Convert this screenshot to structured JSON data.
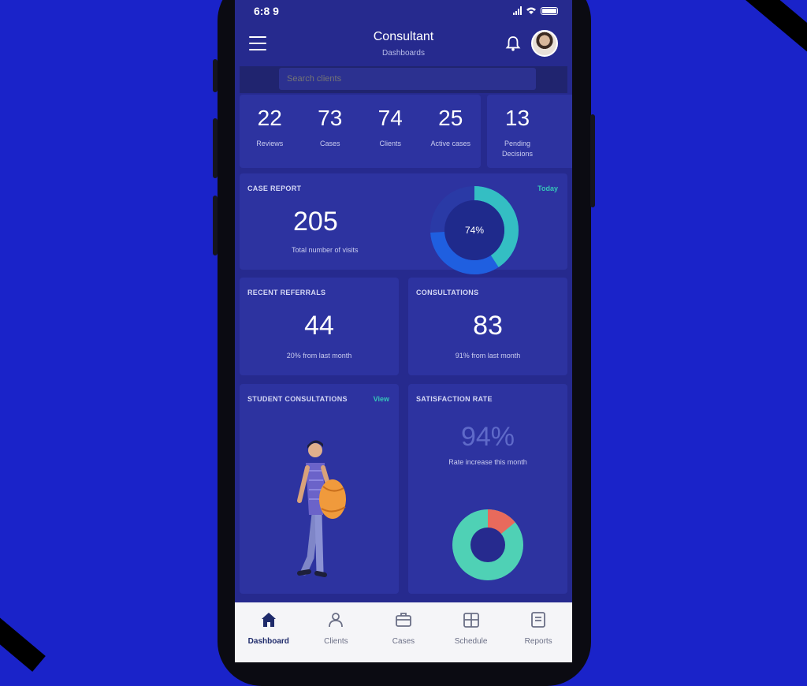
{
  "status": {
    "time": "6:8 9"
  },
  "header": {
    "title": "Consultant",
    "subtitle": "Dashboards"
  },
  "search": {
    "placeholder": "Search clients"
  },
  "stats": [
    {
      "value": "22",
      "label": "Reviews"
    },
    {
      "value": "73",
      "label": "Cases"
    },
    {
      "value": "74",
      "label": "Clients"
    },
    {
      "value": "25",
      "label": "Active cases"
    },
    {
      "value": "13",
      "label": "Pending Decisions"
    }
  ],
  "cases_card": {
    "title": "Case Report",
    "tag": "Today",
    "value": "205",
    "caption": "Total number of visits",
    "donut_label": "74%",
    "donut_percent": 74,
    "colors": {
      "primary": "#1f5fe0",
      "secondary": "#36c9c0",
      "track": "#2a3aa6"
    }
  },
  "active_card": {
    "title": "Recent Referrals",
    "value": "44",
    "caption": "20% from last month"
  },
  "completed_card": {
    "title": "Consultations",
    "value": "83",
    "caption": "91% from last month"
  },
  "illustration_card": {
    "title": "Student Consultations",
    "tag": "View"
  },
  "rate_card": {
    "title": "Satisfaction Rate",
    "value": "94%",
    "caption": "Rate increase this month",
    "pie_percent": 14,
    "colors": {
      "segment": "#e86a5c",
      "rest": "#4fd1b5",
      "hole": "#262a8e"
    }
  },
  "nav": [
    {
      "label": "Dashboard",
      "icon": "home-icon",
      "active": true
    },
    {
      "label": "Clients",
      "icon": "clients-icon",
      "active": false
    },
    {
      "label": "Cases",
      "icon": "briefcase-icon",
      "active": false
    },
    {
      "label": "Schedule",
      "icon": "calendar-icon",
      "active": false
    },
    {
      "label": "Reports",
      "icon": "reports-icon",
      "active": false
    }
  ]
}
